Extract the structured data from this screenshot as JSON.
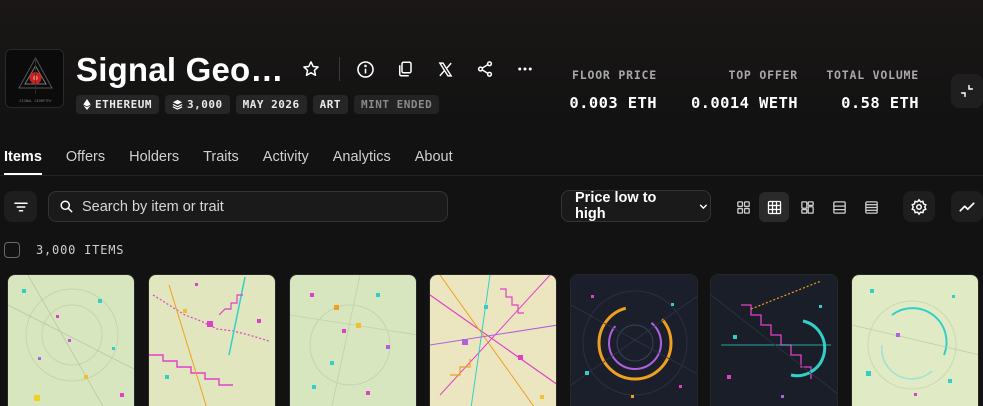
{
  "collection": {
    "title": "Signal Geometry",
    "logo_text": "SIGNAL GEOMETRY",
    "badges": [
      {
        "icon": "ethereum-icon",
        "label": "ETHEREUM"
      },
      {
        "icon": "layers-icon",
        "label": "3,000"
      },
      {
        "label": "MAY 2026"
      },
      {
        "label": "ART"
      },
      {
        "label": "MINT ENDED",
        "muted": true
      }
    ]
  },
  "header_actions": [
    "star-icon",
    "info-icon",
    "copy-icon",
    "x-icon",
    "share-icon",
    "more-icon"
  ],
  "stats": [
    {
      "label": "FLOOR PRICE",
      "value": "0.003 ETH"
    },
    {
      "label": "TOP OFFER",
      "value": "0.0014 WETH"
    },
    {
      "label": "TOTAL VOLUME",
      "value": "0.58 ETH"
    }
  ],
  "tabs": [
    "Items",
    "Offers",
    "Holders",
    "Traits",
    "Activity",
    "Analytics",
    "About"
  ],
  "active_tab": "Items",
  "search": {
    "placeholder": "Search by item or trait"
  },
  "sort": {
    "selected": "Price low to high"
  },
  "views": [
    "grid-small-icon",
    "grid-medium-icon",
    "grid-large-icon",
    "list-icon",
    "table-icon"
  ],
  "active_view": "grid-medium-icon",
  "items_count_label": "3,000 ITEMS",
  "colors": {
    "background": "#121212",
    "card_light": "#d9e8c0",
    "card_dark": "#1a1e2a",
    "accent_pink": "#e040c8",
    "accent_cyan": "#30d0c8",
    "accent_orange": "#f0a020"
  },
  "cards": [
    {
      "theme": "light"
    },
    {
      "theme": "light"
    },
    {
      "theme": "light"
    },
    {
      "theme": "light"
    },
    {
      "theme": "dark"
    },
    {
      "theme": "dark"
    },
    {
      "theme": "light"
    }
  ]
}
